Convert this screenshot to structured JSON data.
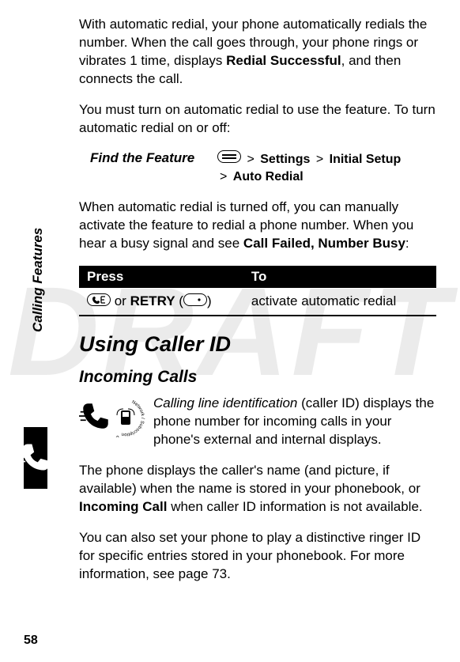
{
  "watermark": "DRAFT",
  "side_label": "Calling Features",
  "page_number": "58",
  "para1_a": "With automatic redial, your phone automatically redials the number. When the call goes through, your phone rings or vibrates 1 time, displays ",
  "para1_b": "Redial Successful",
  "para1_c": ", and then connects the call.",
  "para2": "You must turn on automatic redial to use the feature. To turn automatic redial on or off:",
  "find_label": "Find the Feature",
  "nav": {
    "sep": ">",
    "items": [
      "Settings",
      "Initial Setup",
      "Auto Redial"
    ]
  },
  "para3_a": "When automatic redial is turned off, you can manually activate the feature to redial a phone number. When you hear a busy signal and see ",
  "para3_b": "Call Failed, Number Busy",
  "para3_c": ":",
  "table": {
    "col_press": "Press",
    "col_to": "To",
    "row_press_or": " or ",
    "row_press_retry": "RETRY",
    "row_press_paren_open": " (",
    "row_press_paren_close": ")",
    "row_to": "activate automatic redial"
  },
  "h2": "Using Caller ID",
  "h3": "Incoming Calls",
  "para4_a": "Calling line identification",
  "para4_b": " (caller ID) displays the phone number for incoming calls in your phone's external and internal displays.",
  "para5_a": "The phone displays the caller's name (and picture, if available) when the name is stored in your phonebook, or ",
  "para5_b": "Incoming Call",
  "para5_c": " when caller ID information is not available.",
  "para6": "You can also set your phone to play a distinctive ringer ID for specific entries stored in your phonebook. For more information, see page 73."
}
